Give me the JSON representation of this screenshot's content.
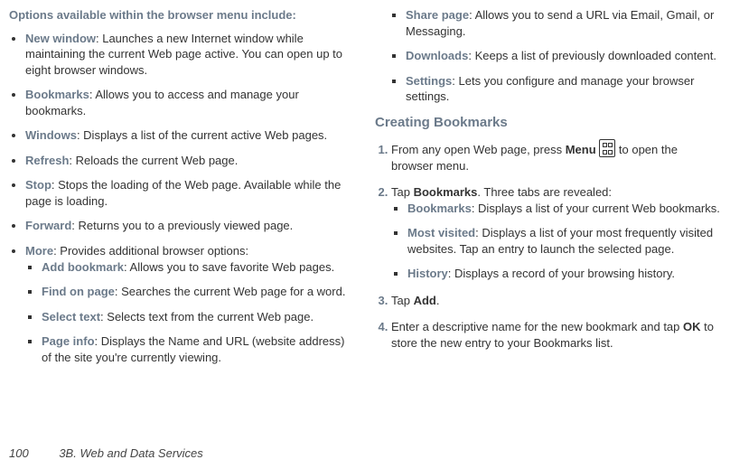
{
  "left": {
    "intro": "Options available within the browser menu include:",
    "items": [
      {
        "term": "New window",
        "desc": ": Launches a new Internet window while maintaining the current Web page active. You can open up to eight browser windows."
      },
      {
        "term": "Bookmarks",
        "desc": ": Allows you to access and manage your bookmarks."
      },
      {
        "term": "Windows",
        "desc": ": Displays a list of the current active Web pages."
      },
      {
        "term": "Refresh",
        "desc": ": Reloads the current Web page."
      },
      {
        "term": "Stop",
        "desc": ": Stops the loading of the Web page. Available while the page is loading."
      },
      {
        "term": "Forward",
        "desc": ": Returns you to a previously viewed page."
      },
      {
        "term": "More",
        "desc": ": Provides additional browser options:",
        "sub": [
          {
            "term": "Add bookmark",
            "desc": ": Allows you to save favorite Web pages."
          },
          {
            "term": "Find on page",
            "desc": ": Searches the current Web page for a word."
          },
          {
            "term": "Select text",
            "desc": ": Selects text from the current Web page."
          },
          {
            "term": "Page info",
            "desc": ": Displays the Name and URL (website address) of the site you're currently viewing."
          }
        ]
      }
    ]
  },
  "right": {
    "more_cont": [
      {
        "term": "Share page",
        "desc": ": Allows you to send a URL via Email, Gmail, or Messaging."
      },
      {
        "term": "Downloads",
        "desc": ": Keeps a list of previously downloaded content."
      },
      {
        "term": "Settings",
        "desc": ": Lets you configure and manage your browser settings."
      }
    ],
    "subhead": "Creating Bookmarks",
    "steps": [
      {
        "pre": "From any open Web page, press ",
        "bold1": "Menu",
        "mid": " ",
        "post": " to open the browser menu."
      },
      {
        "pre": "Tap ",
        "bold1": "Bookmarks",
        "post": ". Three tabs are revealed:",
        "sub": [
          {
            "term": "Bookmarks",
            "desc": ": Displays a list of your current Web bookmarks."
          },
          {
            "term": "Most visited",
            "desc": ": Displays a list of your most frequently visited websites. Tap an entry to launch the selected page."
          },
          {
            "term": "History",
            "desc": ": Displays a record of your browsing history."
          }
        ]
      },
      {
        "pre": "Tap ",
        "bold1": "Add",
        "post": "."
      },
      {
        "pre": "Enter a descriptive name for the new bookmark and tap ",
        "bold1": "OK",
        "post": " to store the new entry to your Bookmarks list."
      }
    ]
  },
  "footer": {
    "page": "100",
    "title": "3B. Web and Data Services"
  }
}
